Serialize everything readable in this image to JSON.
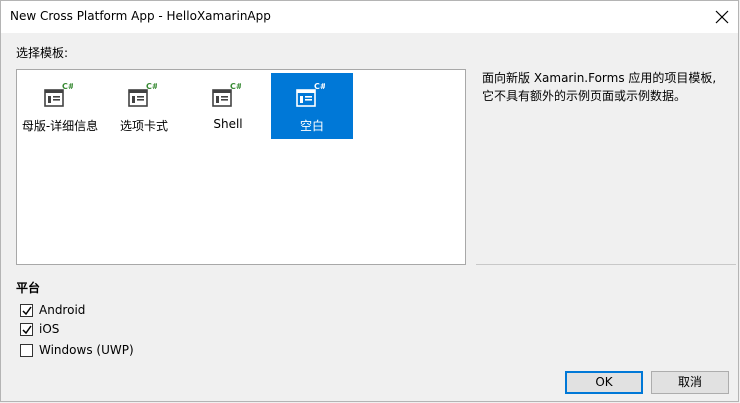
{
  "window": {
    "title": "New Cross Platform App - HelloXamarinApp"
  },
  "templates": {
    "label": "选择模板:",
    "items": [
      {
        "label": "母版-详细信息",
        "icon": "csharp-template-icon",
        "selected": false
      },
      {
        "label": "选项卡式",
        "icon": "csharp-template-icon",
        "selected": false
      },
      {
        "label": "Shell",
        "icon": "csharp-template-icon",
        "selected": false
      },
      {
        "label": "空白",
        "icon": "csharp-template-icon",
        "selected": true
      }
    ],
    "description_line1": "面向新版 Xamarin.Forms 应用的项目模板,",
    "description_line2": "它不具有额外的示例页面或示例数据。"
  },
  "platform": {
    "heading": "平台",
    "options": [
      {
        "label": "Android",
        "checked": true
      },
      {
        "label": "iOS",
        "checked": true
      },
      {
        "label": "Windows (UWP)",
        "checked": false
      }
    ]
  },
  "buttons": {
    "ok": "OK",
    "cancel": "取消"
  },
  "colors": {
    "accent": "#0078d7",
    "csharp_badge": "#388a34"
  }
}
